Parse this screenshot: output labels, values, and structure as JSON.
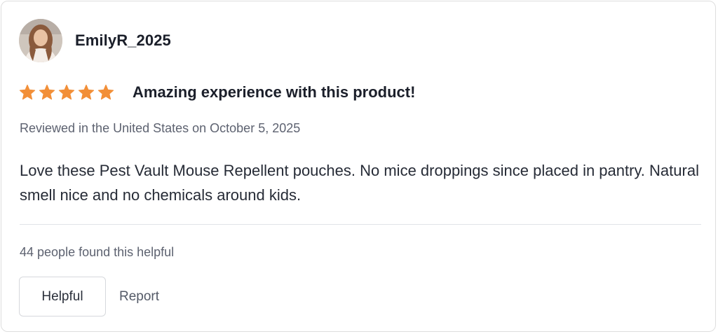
{
  "review": {
    "username": "EmilyR_2025",
    "avatar_icon": "user-avatar-photo",
    "rating": 5,
    "rating_max": 5,
    "star_color": "#f28f38",
    "title": "Amazing experience with this product!",
    "meta": "Reviewed in the United States on October 5, 2025",
    "body": "Love these Pest Vault Mouse Repellent pouches. No mice droppings since placed in pantry. Natural smell nice and no chemicals around kids.",
    "helpful_count_text": "44 people found this helpful",
    "helpful_button_label": "Helpful",
    "report_label": "Report"
  }
}
